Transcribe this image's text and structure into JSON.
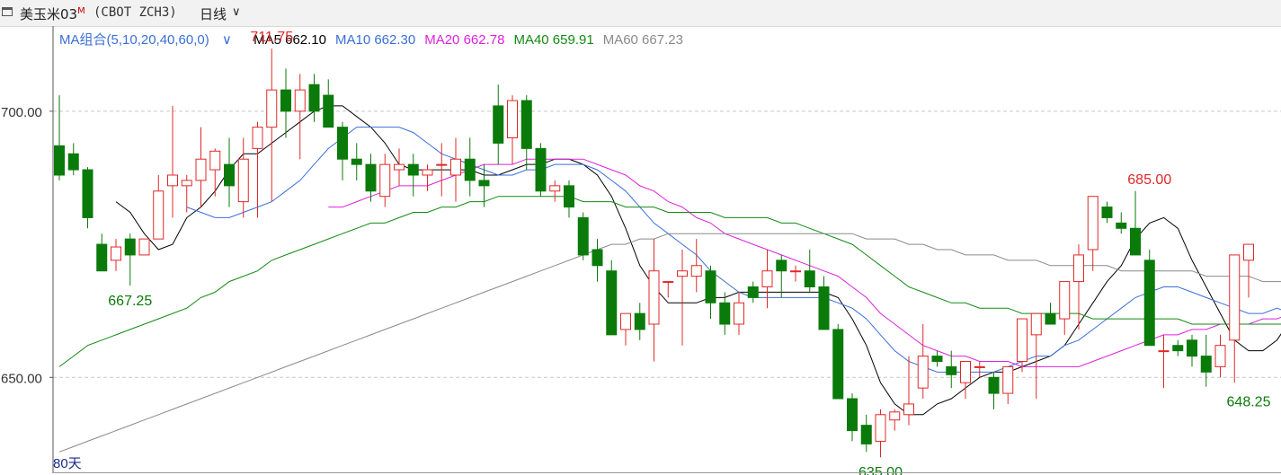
{
  "header": {
    "title": "美玉米03",
    "title_mark": "M",
    "code": "(CBOT ZCH3)",
    "period": "日线",
    "period_chevron_icon": "chevron-down-icon"
  },
  "legend": {
    "group_label": "MA组合(5,10,20,40,60,0)",
    "group_chevron_icon": "chevron-down-icon",
    "items": [
      {
        "label": "MA5 662.10",
        "color": "#000000"
      },
      {
        "label": "MA10 662.30",
        "color": "#3a6fd8"
      },
      {
        "label": "MA20 662.78",
        "color": "#dd22dd"
      },
      {
        "label": "MA40 659.91",
        "color": "#138a13"
      },
      {
        "label": "MA60 667.23",
        "color": "#8a8a8a"
      }
    ]
  },
  "footer": {
    "days_label": "80天"
  },
  "colors": {
    "up": "#e02828",
    "down": "#0a7a0a",
    "grid": "#c8c8c8",
    "axis": "#555555"
  },
  "chart_data": {
    "type": "candlestick",
    "ylim": [
      632,
      716
    ],
    "y_ticks": [
      {
        "value": 700,
        "label": "700.00"
      },
      {
        "value": 650,
        "label": "650.00"
      }
    ],
    "grid": "dashed-horizontal",
    "candles": [
      [
        693.5,
        703,
        687,
        688
      ],
      [
        692,
        694,
        688,
        689
      ],
      [
        689,
        689.5,
        678,
        680
      ],
      [
        675,
        677,
        670,
        670
      ],
      [
        672,
        676,
        670,
        674.5
      ],
      [
        676,
        677,
        667.25,
        673
      ],
      [
        673,
        676,
        673,
        676
      ],
      [
        676,
        688,
        676,
        685
      ],
      [
        686,
        701,
        680,
        688
      ],
      [
        686,
        688,
        681,
        687
      ],
      [
        687,
        697,
        682,
        691
      ],
      [
        689,
        693,
        684,
        692.5
      ],
      [
        690,
        695,
        682,
        686
      ],
      [
        683,
        695,
        680,
        691
      ],
      [
        693,
        698,
        680,
        697
      ],
      [
        697,
        711.75,
        683,
        704
      ],
      [
        704,
        708,
        695,
        700
      ],
      [
        700,
        707,
        691,
        704
      ],
      [
        705,
        707,
        698,
        700
      ],
      [
        703,
        706,
        698,
        697
      ],
      [
        697,
        698,
        687,
        691
      ],
      [
        691,
        694,
        687,
        690
      ],
      [
        690,
        692,
        683,
        685
      ],
      [
        684,
        692,
        682,
        690
      ],
      [
        689,
        693,
        686,
        690
      ],
      [
        690,
        692,
        684,
        688
      ],
      [
        688,
        690,
        685,
        689
      ],
      [
        690,
        694,
        684,
        690
      ],
      [
        688,
        695,
        683,
        691
      ],
      [
        691,
        695,
        684,
        687
      ],
      [
        687,
        690,
        682,
        686
      ],
      [
        701,
        705,
        690,
        694
      ],
      [
        695,
        703,
        690,
        702
      ],
      [
        702,
        703,
        689,
        693
      ],
      [
        693,
        694,
        684,
        685
      ],
      [
        685,
        687,
        683,
        686
      ],
      [
        686,
        687,
        680,
        682
      ],
      [
        680,
        681,
        672,
        673
      ],
      [
        674,
        676,
        668,
        671
      ],
      [
        670,
        672,
        658,
        658
      ],
      [
        659,
        662,
        656,
        662
      ],
      [
        662,
        664,
        657,
        659
      ],
      [
        660,
        676,
        653,
        670
      ],
      [
        668,
        668,
        665,
        668
      ],
      [
        669,
        674,
        656,
        670
      ],
      [
        669,
        676,
        666,
        671
      ],
      [
        670,
        671,
        661,
        664
      ],
      [
        664,
        666,
        658,
        660
      ],
      [
        660,
        666,
        658,
        664
      ],
      [
        667,
        668,
        664,
        665
      ],
      [
        667,
        674,
        663,
        670
      ],
      [
        672,
        673,
        665,
        670
      ],
      [
        670,
        671,
        668,
        670
      ],
      [
        670,
        674,
        666,
        667
      ],
      [
        667,
        669,
        659,
        659
      ],
      [
        659,
        660,
        646,
        646
      ],
      [
        646,
        647,
        638,
        640
      ],
      [
        641,
        643,
        636,
        637.5
      ],
      [
        638,
        644,
        635,
        643
      ],
      [
        642,
        644,
        640,
        643.5
      ],
      [
        643,
        654,
        641,
        645
      ],
      [
        648,
        660,
        646,
        654
      ],
      [
        654,
        655,
        652,
        653
      ],
      [
        652,
        655,
        648,
        650.5
      ],
      [
        649,
        653,
        646,
        653
      ],
      [
        652,
        653,
        650,
        652
      ],
      [
        650,
        651,
        644,
        647
      ],
      [
        647,
        649,
        645,
        652
      ],
      [
        653,
        658,
        651,
        661
      ],
      [
        658,
        660,
        646,
        662
      ],
      [
        662,
        664,
        660,
        660
      ],
      [
        661,
        666,
        658,
        668
      ],
      [
        668,
        675,
        659,
        673
      ],
      [
        674,
        684,
        670,
        684
      ],
      [
        682,
        683,
        679,
        680
      ],
      [
        679,
        681,
        677,
        678
      ],
      [
        678,
        685,
        675,
        673
      ],
      [
        672,
        674,
        658,
        656
      ],
      [
        655,
        658,
        648,
        655
      ],
      [
        656,
        657,
        654,
        655
      ],
      [
        657,
        658,
        652,
        654
      ],
      [
        654,
        658,
        648.25,
        651
      ],
      [
        652,
        658,
        650,
        656
      ],
      [
        657,
        668,
        649,
        673
      ],
      [
        672,
        675,
        665,
        675
      ]
    ],
    "ma": [
      {
        "name": "MA5",
        "color": "#000000",
        "values": [
          null,
          null,
          null,
          null,
          683,
          681,
          677,
          674,
          675,
          680,
          682,
          685,
          689,
          692,
          692,
          694,
          696,
          698,
          700,
          701,
          701,
          699,
          697,
          694,
          690,
          689,
          689,
          689,
          689,
          689,
          688,
          688,
          689,
          690,
          690,
          691,
          691,
          690,
          688,
          684,
          678,
          671,
          667,
          664,
          664,
          664,
          665,
          665,
          666,
          666,
          666,
          666,
          666,
          666,
          666,
          665,
          661,
          656,
          649,
          645,
          643,
          643,
          645,
          646,
          648,
          650,
          651,
          651,
          652,
          653,
          654,
          656,
          660,
          664,
          668,
          671,
          676,
          679,
          680,
          678,
          672,
          667,
          662,
          657,
          655,
          655,
          657,
          661,
          662
        ]
      },
      {
        "name": "MA10",
        "color": "#3a6fd8",
        "values": [
          null,
          null,
          null,
          null,
          null,
          null,
          null,
          null,
          null,
          682,
          681,
          680,
          680,
          681,
          682,
          683,
          685,
          687,
          690,
          693,
          695,
          697,
          697,
          697,
          697,
          696,
          694,
          692,
          691,
          690,
          689,
          688,
          688,
          689,
          689,
          690,
          690,
          690,
          689,
          687,
          685,
          682,
          679,
          677,
          675,
          673,
          670,
          668,
          666,
          665,
          665,
          665,
          665,
          665,
          665,
          664,
          663,
          661,
          658,
          655,
          653,
          652,
          651,
          651,
          651,
          651,
          651,
          652,
          653,
          654,
          654,
          656,
          657,
          659,
          661,
          663,
          665,
          666,
          667,
          667,
          666,
          665,
          664,
          663,
          662,
          662,
          663,
          662,
          662
        ]
      },
      {
        "name": "MA20",
        "color": "#dd22dd",
        "values": [
          null,
          null,
          null,
          null,
          null,
          null,
          null,
          null,
          null,
          null,
          null,
          null,
          null,
          null,
          null,
          null,
          null,
          null,
          null,
          682,
          682,
          683,
          684,
          685,
          686,
          686,
          686,
          687,
          688,
          689,
          690,
          690,
          690,
          691,
          691,
          691,
          691,
          691,
          690,
          689,
          688,
          686,
          685,
          683,
          682,
          680,
          679,
          677,
          676,
          675,
          674,
          673,
          672,
          671,
          670,
          669,
          667,
          665,
          662,
          660,
          658,
          656,
          655,
          654,
          654,
          653,
          653,
          653,
          652,
          652,
          652,
          652,
          652,
          653,
          654,
          655,
          656,
          657,
          658,
          658,
          659,
          659,
          660,
          660,
          660,
          661,
          661,
          662,
          663
        ]
      },
      {
        "name": "MA40",
        "color": "#138a13",
        "values": [
          652,
          654,
          656,
          657,
          658,
          659,
          660,
          661,
          662,
          663,
          665,
          666,
          668,
          669,
          670,
          672,
          673,
          674,
          675,
          676,
          677,
          678,
          679,
          679,
          680,
          681,
          681,
          682,
          682,
          683,
          683,
          684,
          684,
          684,
          684,
          684,
          684,
          683,
          683,
          683,
          682,
          682,
          682,
          681,
          681,
          681,
          681,
          680,
          680,
          680,
          680,
          679,
          679,
          678,
          677,
          676,
          675,
          673,
          671,
          669,
          667,
          666,
          665,
          664,
          664,
          663,
          663,
          663,
          662,
          662,
          662,
          662,
          662,
          661,
          661,
          661,
          661,
          661,
          661,
          661,
          660,
          660,
          660,
          660,
          660,
          660,
          660,
          660,
          660
        ]
      },
      {
        "name": "MA60",
        "color": "#8a8a8a",
        "values": [
          636,
          637,
          638,
          639,
          640,
          641,
          642,
          643,
          644,
          645,
          646,
          647,
          648,
          649,
          650,
          651,
          652,
          653,
          654,
          655,
          656,
          657,
          658,
          659,
          660,
          661,
          662,
          663,
          664,
          665,
          666,
          667,
          668,
          669,
          670,
          671,
          672,
          673,
          674,
          675,
          675,
          676,
          676,
          677,
          677,
          677,
          677,
          677,
          677,
          677,
          677,
          677,
          677,
          677,
          677,
          677,
          677,
          676,
          676,
          676,
          675,
          675,
          674,
          674,
          673,
          673,
          673,
          672,
          672,
          672,
          671,
          671,
          671,
          671,
          671,
          670,
          670,
          670,
          670,
          670,
          670,
          669,
          669,
          669,
          669,
          668,
          668,
          668,
          667
        ]
      }
    ],
    "annotations": [
      {
        "index": 15,
        "value": 711.75,
        "label": "711.75",
        "color": "#e02828",
        "where": "above"
      },
      {
        "index": 5,
        "value": 667.25,
        "label": "667.25",
        "color": "#0a7a0a",
        "where": "below"
      },
      {
        "index": 77,
        "value": 685.0,
        "label": "685.00",
        "color": "#e02828",
        "where": "above"
      },
      {
        "index": 58,
        "value": 635.0,
        "label": "635.00",
        "color": "#0a7a0a",
        "where": "below"
      },
      {
        "index": 84,
        "value": 648.25,
        "label": "648.25",
        "color": "#0a7a0a",
        "where": "below"
      }
    ]
  }
}
